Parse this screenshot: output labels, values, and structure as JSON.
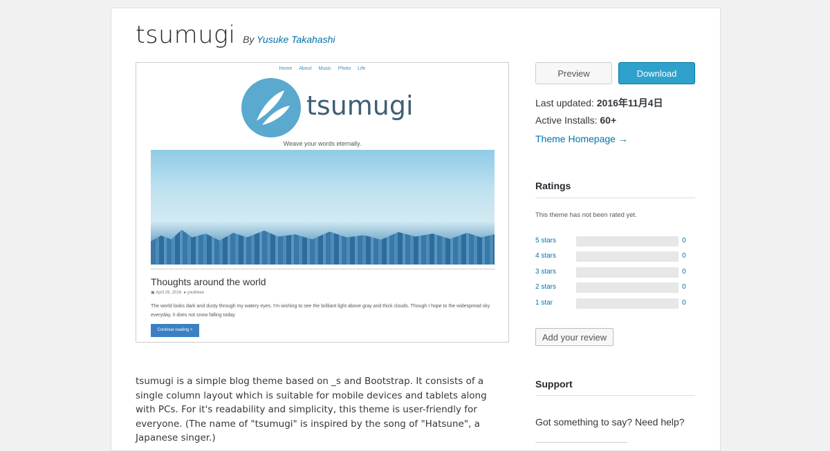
{
  "theme": {
    "name": "tsumugi",
    "by": "By",
    "author": "Yusuke Takahashi"
  },
  "screenshot": {
    "nav": [
      "Home",
      "About",
      "Music",
      "Photo",
      "Life"
    ],
    "logo_text": "tsumugi",
    "tagline": "Weave your words eternally.",
    "post_title": "Thoughts around the world",
    "post_date": "April 29, 2016",
    "post_author": "youthkee",
    "post_body": "The world looks dark and dusty through my watery eyes. I'm wishing to see the brilliant light above gray and thick clouds. Though I hope to the widespread sky everyday, it does not snow falling today.",
    "continue_label": "Continue reading >"
  },
  "description": "tsumugi is a simple blog theme based on _s and Bootstrap. It consists of a single column layout which is suitable for mobile devices and tablets along with PCs. For it's readability and simplicity, this theme is user-friendly for everyone. (The name of \"tsumugi\" is inspired by the song of \"Hatsune\", a Japanese singer.)",
  "sidebar": {
    "preview_label": "Preview",
    "download_label": "Download",
    "last_updated_label": "Last updated:",
    "last_updated_value": "2016年11月4日",
    "active_installs_label": "Active Installs:",
    "active_installs_value": "60+",
    "homepage_link": "Theme Homepage →",
    "ratings_title": "Ratings",
    "not_rated": "This theme has not been rated yet.",
    "ratings": [
      {
        "label": "5 stars",
        "count": "0"
      },
      {
        "label": "4 stars",
        "count": "0"
      },
      {
        "label": "3 stars",
        "count": "0"
      },
      {
        "label": "2 stars",
        "count": "0"
      },
      {
        "label": "1 star",
        "count": "0"
      }
    ],
    "review_label": "Add your review",
    "support_title": "Support",
    "support_text": "Got something to say? Need help?"
  },
  "colors": {
    "link": "#0073aa",
    "download": "#2ea2cc",
    "logo_circle": "#5aa9cf"
  }
}
